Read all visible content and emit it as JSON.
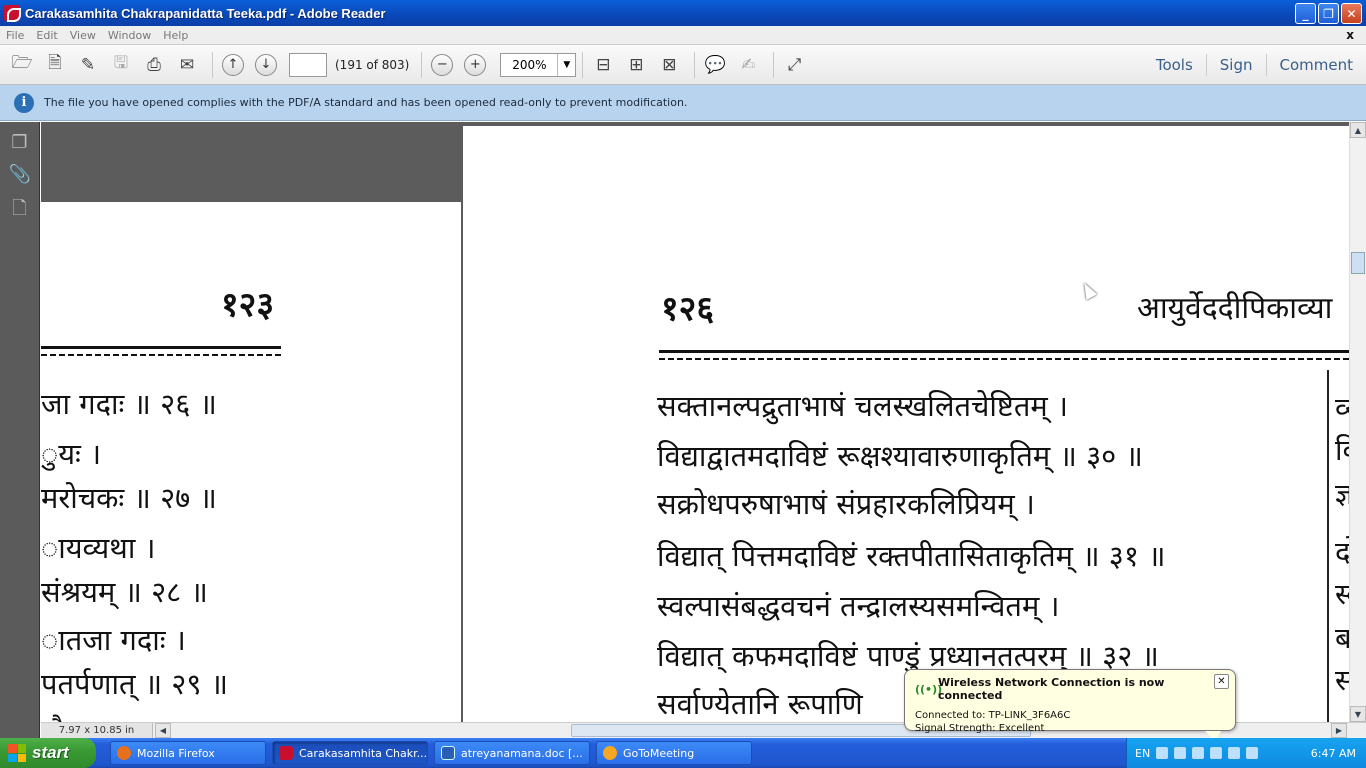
{
  "window": {
    "title": "Carakasamhita Chakrapanidatta Teeka.pdf - Adobe Reader",
    "minimize": "_",
    "restore": "❐",
    "close": "✕"
  },
  "menu": {
    "items": [
      "File",
      "Edit",
      "View",
      "Window",
      "Help"
    ],
    "close": "x"
  },
  "toolbar": {
    "page_input": "",
    "page_count": "(191 of 803)",
    "zoom": "200%",
    "right_tabs": [
      "Tools",
      "Sign",
      "Comment"
    ]
  },
  "infobar": {
    "message": "The file you have opened complies with the PDF/A standard and has been opened read-only to prevent modification."
  },
  "document": {
    "left_page": {
      "page_no": "१२३",
      "lines": [
        "जा गदाः ॥ २६ ॥",
        "ुयः ।",
        "मरोचकः ॥ २७ ॥",
        "ायव्यथा ।",
        "संश्रयम् ॥ २८ ॥",
        "ातजा गदाः ।",
        "पतर्पणात् ॥ २९ ॥",
        "ै"
      ]
    },
    "right_page": {
      "page_no": "१२६",
      "header": "आयुर्वेददीपिकाव्या",
      "lines": [
        "सक्तानल्पद्रुताभाषं चलस्खलितचेष्टितम् ।",
        "विद्याद्वातमदाविष्टं रूक्षश्यावारुणाकृतिम् ॥ ३० ॥",
        "सक्रोधपरुषाभाषं संप्रहारकलिप्रियम् ।",
        "विद्यात् पित्तमदाविष्टं रक्तपीतासिताकृतिम् ॥ ३१ ॥",
        "स्वल्पासंबद्धवचनं तन्द्रालस्यसमन्वितम् ।",
        "विद्यात् कफमदाविष्टं पाण्डुं प्रध्यानतत्परम् ॥ ३२ ॥",
        "सर्वाण्येतानि रूपाणि"
      ],
      "side_chars": [
        "व्य",
        "कि",
        "ज्ञ",
        "दो",
        "स्व",
        "बा",
        "सं"
      ]
    }
  },
  "status": {
    "page_size": "7.97 x 10.85 in"
  },
  "taskbar": {
    "start": "start",
    "tasks": [
      "Mozilla Firefox",
      "Carakasamhita Chakr...",
      "atreyanamana.doc [...",
      "GoToMeeting"
    ],
    "language": "EN",
    "clock": "6:47 AM"
  },
  "balloon": {
    "title": "Wireless Network Connection is now connected",
    "connected_to": "Connected to: TP-LINK_3F6A6C",
    "signal": "Signal Strength: Excellent",
    "close": "✕"
  }
}
